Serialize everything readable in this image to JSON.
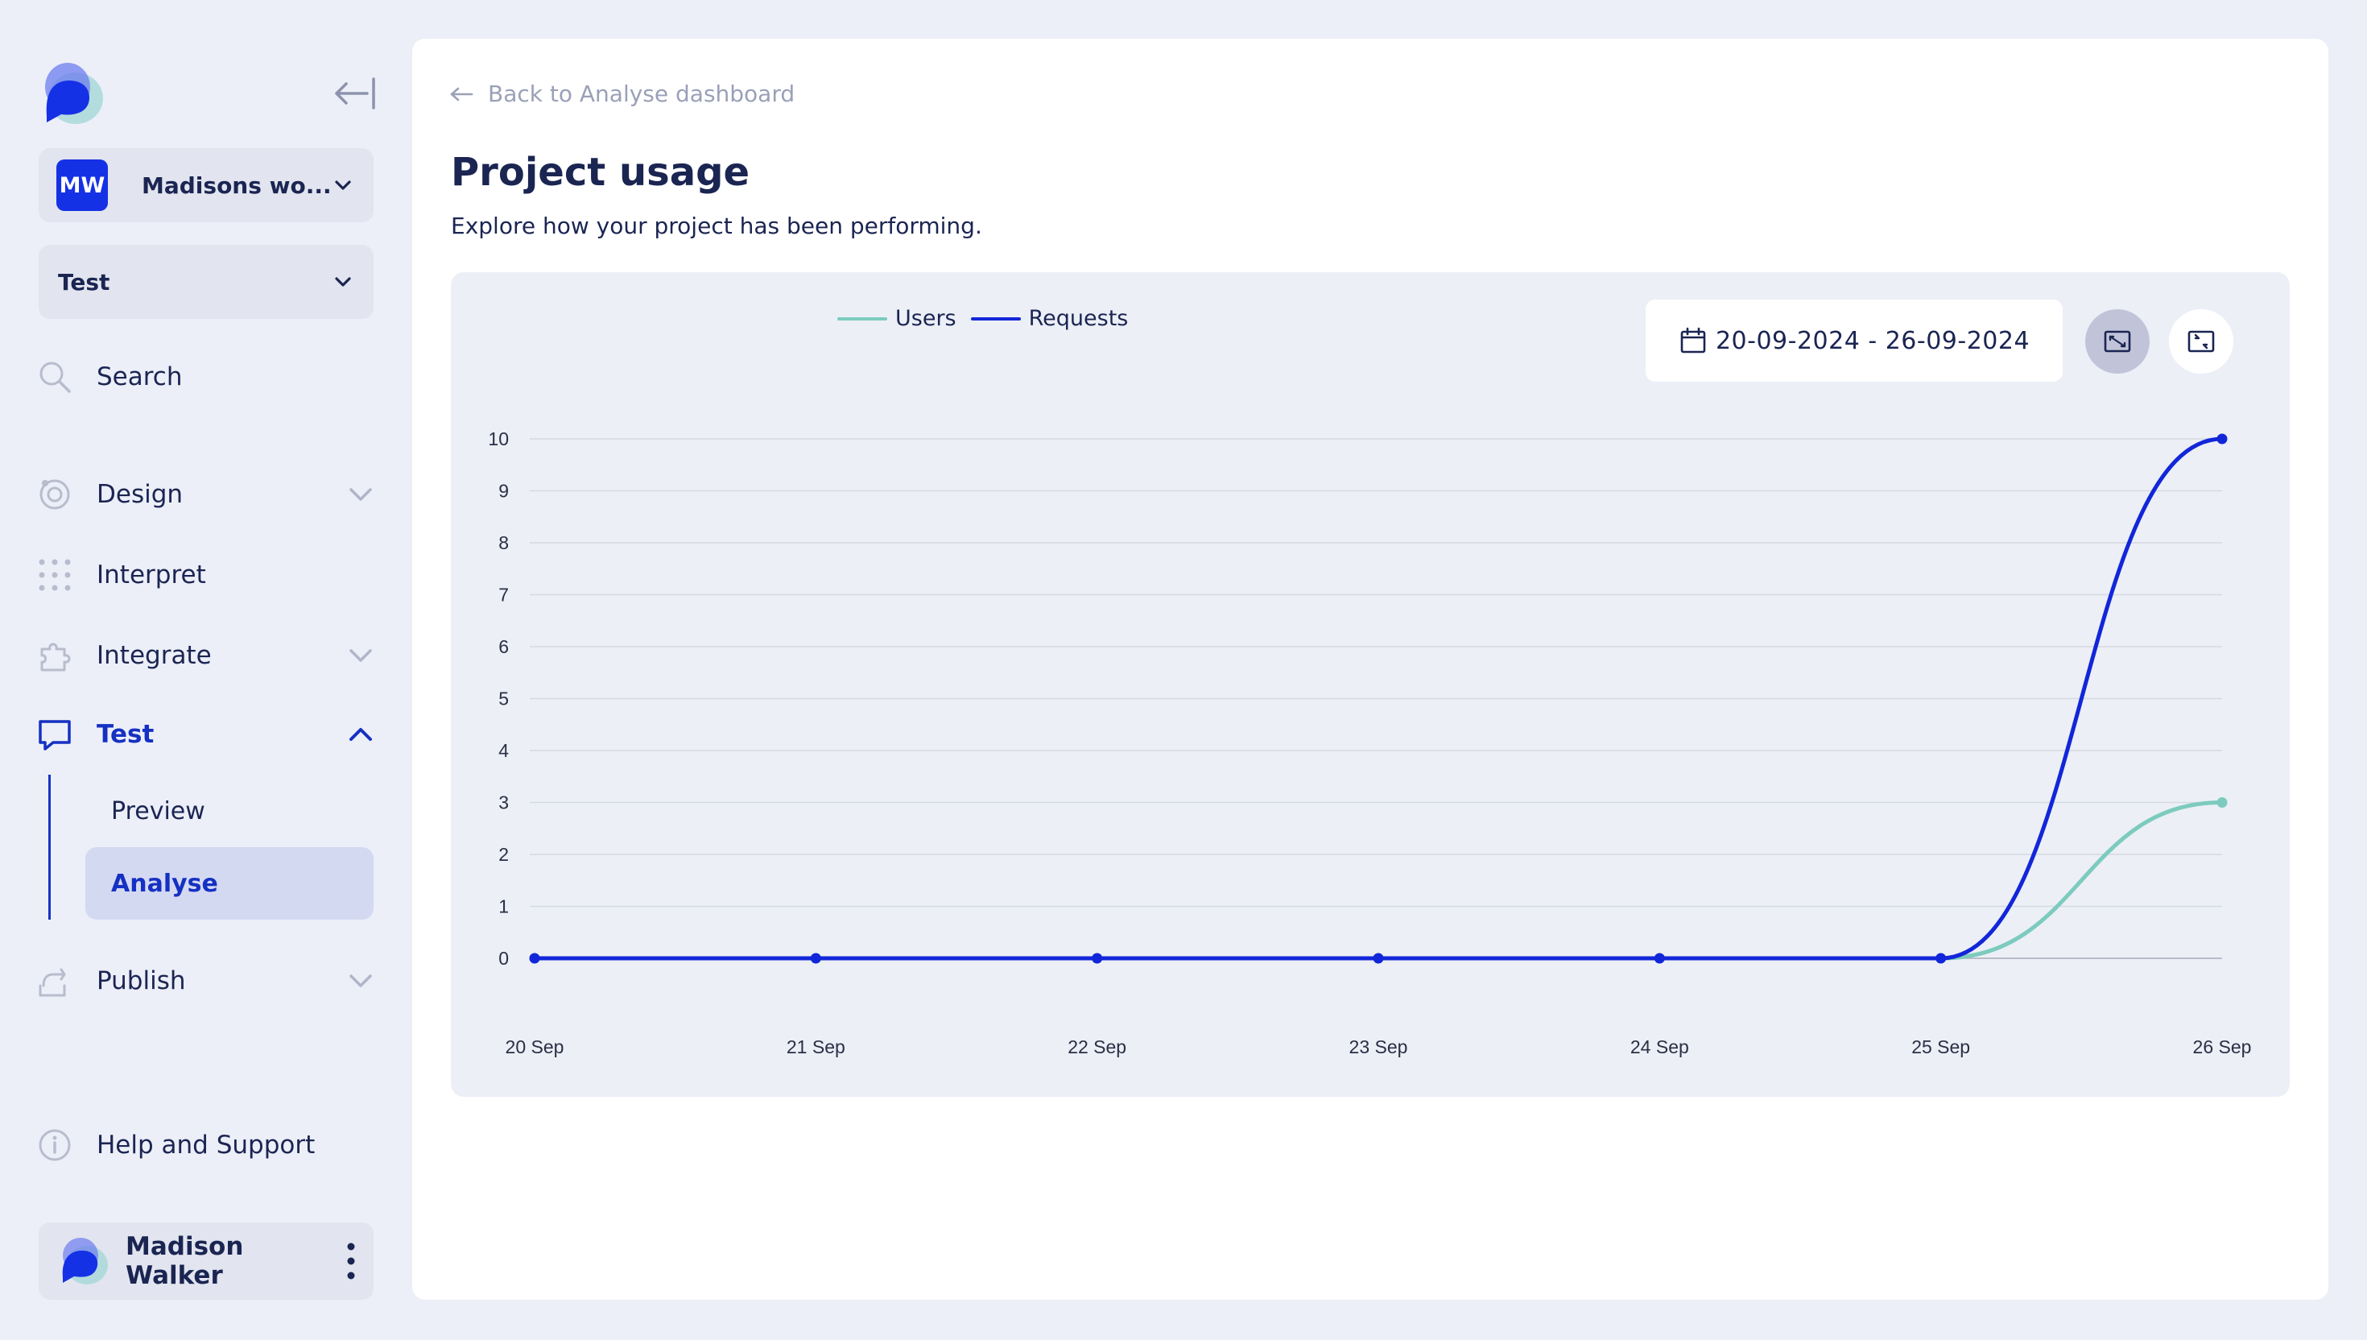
{
  "sidebar": {
    "workspace": {
      "initials": "MW",
      "name": "Madisons wo..."
    },
    "project": {
      "name": "Test"
    },
    "search_label": "Search",
    "nav": [
      {
        "label": "Design",
        "icon": "palette-icon",
        "expandable": true
      },
      {
        "label": "Interpret",
        "icon": "dots-grid-icon",
        "expandable": false
      },
      {
        "label": "Integrate",
        "icon": "puzzle-icon",
        "expandable": true
      },
      {
        "label": "Test",
        "icon": "chat-bubble-icon",
        "expandable": true,
        "expanded": true
      },
      {
        "label": "Publish",
        "icon": "share-icon",
        "expandable": true
      }
    ],
    "test_sub": [
      {
        "label": "Preview"
      },
      {
        "label": "Analyse",
        "selected": true
      }
    ],
    "help_label": "Help and Support",
    "user": {
      "name": "Madison Walker"
    }
  },
  "main": {
    "back_label": "Back to Analyse dashboard",
    "title": "Project usage",
    "subtitle": "Explore how your project has been performing.",
    "date_range": "20-09-2024 - 26-09-2024"
  },
  "colors": {
    "accent": "#1531e6",
    "requests": "#1226d9",
    "users": "#7ccbbe"
  },
  "chart_data": {
    "type": "line",
    "categories": [
      "20 Sep",
      "21 Sep",
      "22 Sep",
      "23 Sep",
      "24 Sep",
      "25 Sep",
      "26 Sep"
    ],
    "series": [
      {
        "name": "Users",
        "values": [
          0,
          0,
          0,
          0,
          0,
          0,
          3
        ]
      },
      {
        "name": "Requests",
        "values": [
          0,
          0,
          0,
          0,
          0,
          0,
          10
        ]
      }
    ],
    "ylim": [
      0,
      10
    ],
    "yticks": [
      0,
      1,
      2,
      3,
      4,
      5,
      6,
      7,
      8,
      9,
      10
    ],
    "grid": true,
    "legend": "top-left"
  }
}
